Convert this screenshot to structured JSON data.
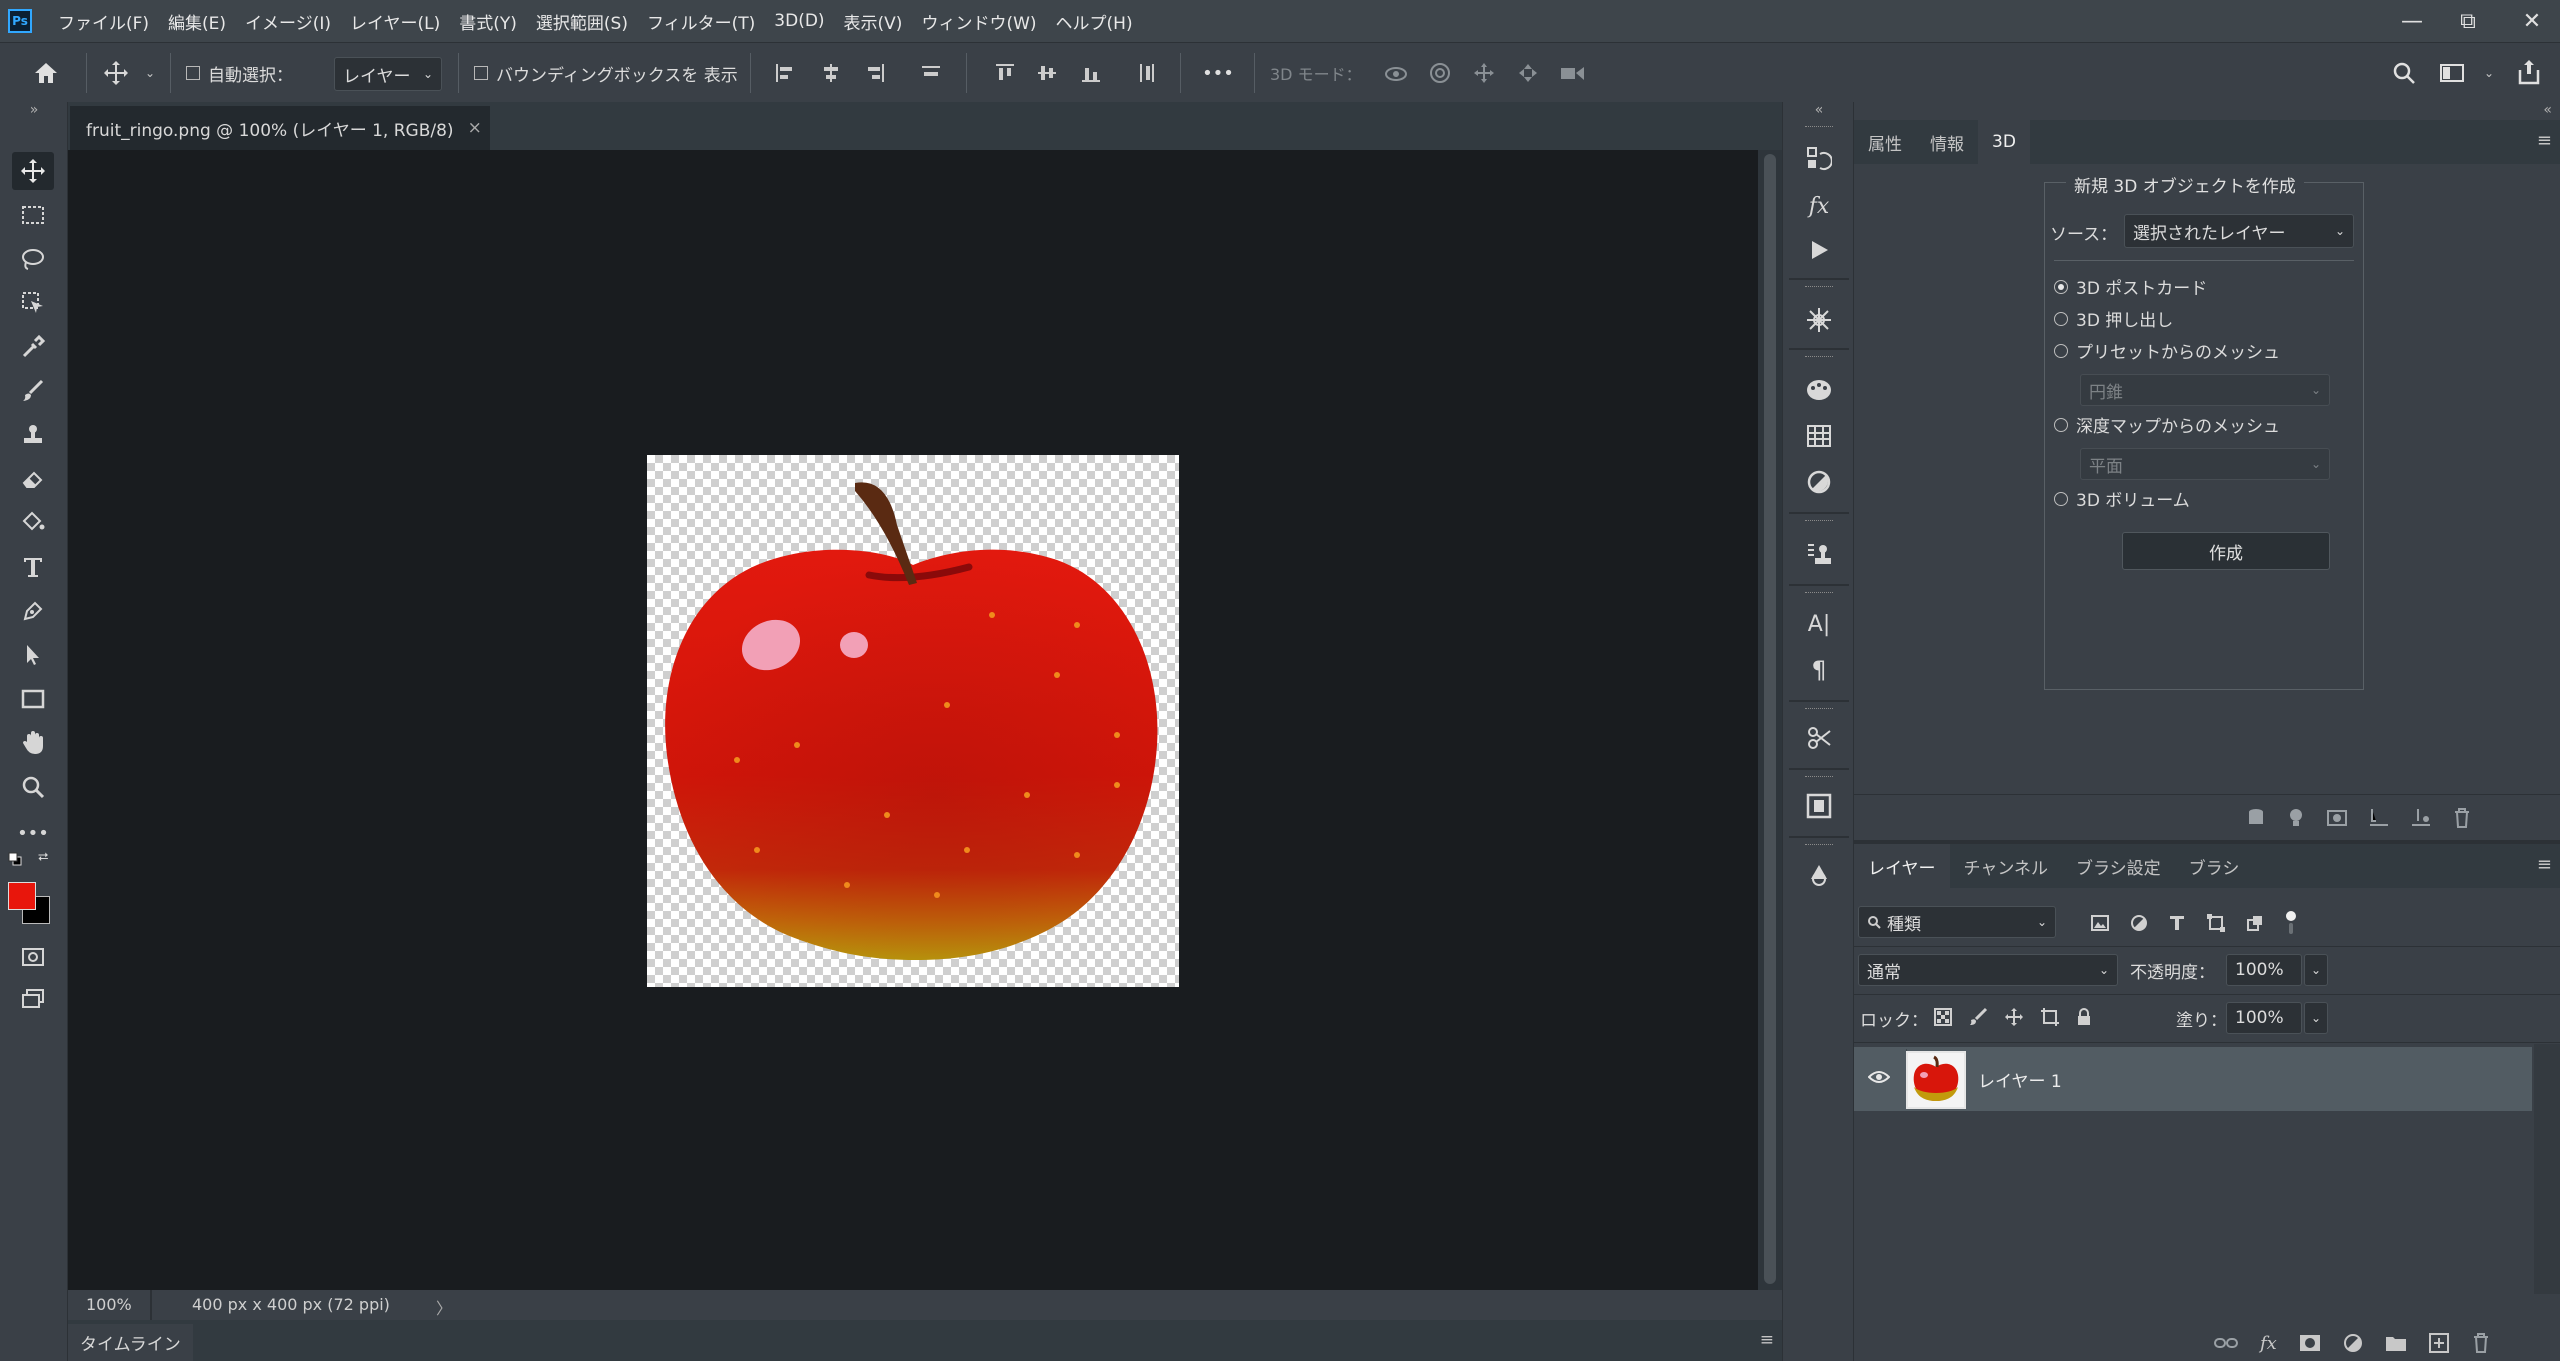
{
  "app": {
    "logo": "Ps"
  },
  "menu": [
    "ファイル(F)",
    "編集(E)",
    "イメージ(I)",
    "レイヤー(L)",
    "書式(Y)",
    "選択範囲(S)",
    "フィルター(T)",
    "3D(D)",
    "表示(V)",
    "ウィンドウ(W)",
    "ヘルプ(H)"
  ],
  "window_controls": {
    "minimize": "—",
    "restore": "⧉",
    "close": "✕"
  },
  "options": {
    "auto_select_label": "自動選択：",
    "layer_dropdown": "レイヤー",
    "bounding_box_label": "バウンディングボックスを 表示",
    "more": "•••",
    "mode_3d_label": "3D モード："
  },
  "document": {
    "tab_title": "fruit_ringo.png @ 100% (レイヤー 1, RGB/8)",
    "tab_close": "×",
    "zoom": "100%",
    "doc_info": "400 px x 400 px (72 ppi)",
    "status_arrow": "〉"
  },
  "timeline": {
    "label": "タイムライン"
  },
  "props_panel": {
    "tabs": [
      "属性",
      "情報",
      "3D"
    ],
    "active_tab": "3D",
    "group_title": "新規 3D オブジェクトを作成",
    "source_label": "ソース：",
    "source_value": "選択されたレイヤー",
    "options": [
      {
        "label": "3D ポストカード",
        "checked": true
      },
      {
        "label": "3D 押し出し",
        "checked": false
      },
      {
        "label": "プリセットからのメッシュ",
        "checked": false
      },
      {
        "label": "深度マップからのメッシュ",
        "checked": false
      },
      {
        "label": "3D ボリューム",
        "checked": false
      }
    ],
    "preset_value": "円錐",
    "depth_value": "平面",
    "create_button": "作成"
  },
  "layers_panel": {
    "tabs": [
      "レイヤー",
      "チャンネル",
      "ブラシ設定",
      "ブラシ"
    ],
    "active_tab": "レイヤー",
    "filter_label": "種類",
    "blend_mode": "通常",
    "opacity_label": "不透明度：",
    "opacity_value": "100%",
    "lock_label": "ロック：",
    "fill_label": "塗り：",
    "fill_value": "100%",
    "layers": [
      {
        "name": "レイヤー 1",
        "visible": true,
        "selected": true
      }
    ]
  },
  "colors": {
    "foreground": "#e8160c",
    "background": "#000000",
    "accent": "#31a8ff"
  }
}
